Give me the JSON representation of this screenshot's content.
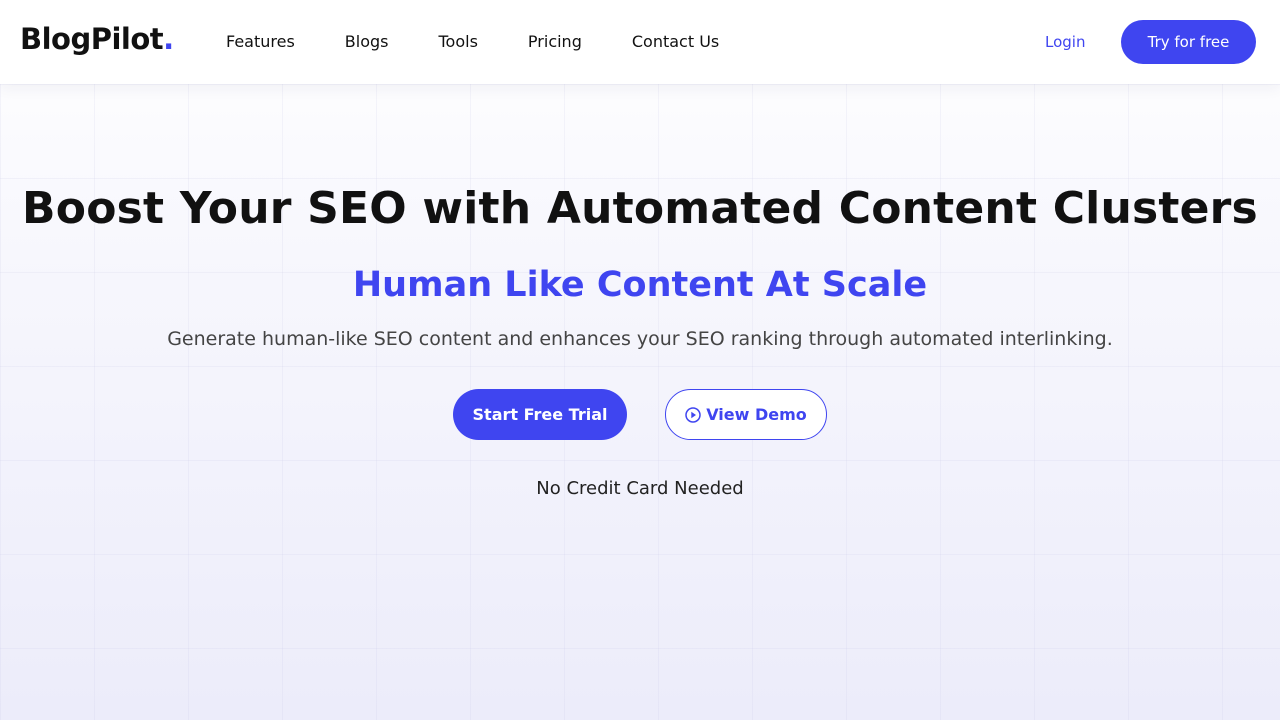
{
  "brand": {
    "name": "BlogPilot",
    "dot": ".",
    "accent": "#3f45f0"
  },
  "nav": {
    "items": [
      {
        "label": "Features"
      },
      {
        "label": "Blogs"
      },
      {
        "label": "Tools"
      },
      {
        "label": "Pricing"
      },
      {
        "label": "Contact Us"
      }
    ],
    "login_label": "Login",
    "try_label": "Try for free"
  },
  "hero": {
    "title": "Boost Your SEO with Automated Content Clusters",
    "subtitle": "Human Like Content At Scale",
    "description": "Generate human-like SEO content and enhances your SEO ranking through automated interlinking.",
    "primary_cta": "Start Free Trial",
    "secondary_cta": "View Demo",
    "secondary_icon": "play-circle-icon",
    "note": "No Credit Card Needed"
  }
}
